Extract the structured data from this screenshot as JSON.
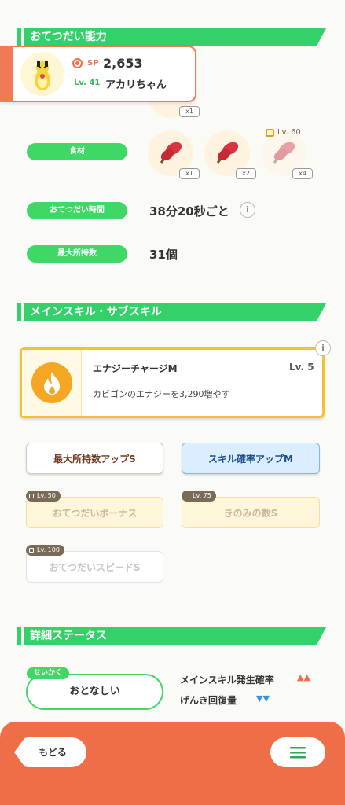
{
  "help_section": {
    "title": "おてつだい能力",
    "ingredients_label": "食材",
    "ingredients": [
      {
        "qty": "x1",
        "locked": false
      },
      {
        "qty": "x2",
        "locked": false
      },
      {
        "qty": "x4",
        "locked": true,
        "unlock_level": "Lv. 60"
      }
    ],
    "top_qty": "x1",
    "help_time_label": "おてつだい時間",
    "help_time_value": "38分20秒ごと",
    "max_carry_label": "最大所持数",
    "max_carry_value": "31個"
  },
  "profile": {
    "sp_label": "SP",
    "sp_value": "2,653",
    "level": "Lv. 41",
    "name": "アカリちゃん"
  },
  "skills_section": {
    "title": "メインスキル・サブスキル",
    "main_skill": {
      "name": "エナジーチャージM",
      "level": "Lv. 5",
      "description": "カビゴンのエナジーを3,290増やす"
    },
    "sub_skills": [
      {
        "label": "最大所持数アップS",
        "lock": ""
      },
      {
        "label": "スキル確率アップM",
        "lock": ""
      },
      {
        "label": "おてつだいボーナス",
        "lock": "Lv. 50"
      },
      {
        "label": "きのみの数S",
        "lock": "Lv. 75"
      },
      {
        "label": "おてつだいスピードS",
        "lock": "Lv. 100"
      }
    ]
  },
  "detail_section": {
    "title": "詳細ステータス",
    "nature_tag": "せいかく",
    "nature_value": "おとなしい",
    "up_stat": "メインスキル発生確率",
    "up_marks": "▲▲",
    "down_stat": "げんき回復量",
    "down_marks": "▼▼"
  },
  "nav": {
    "back_label": "もどる"
  },
  "colors": {
    "accent_green": "#34d16a",
    "bottom_orange": "#f06e47",
    "gold_border": "#f1c233",
    "up_color": "#f06e47",
    "down_color": "#3a8de8"
  }
}
